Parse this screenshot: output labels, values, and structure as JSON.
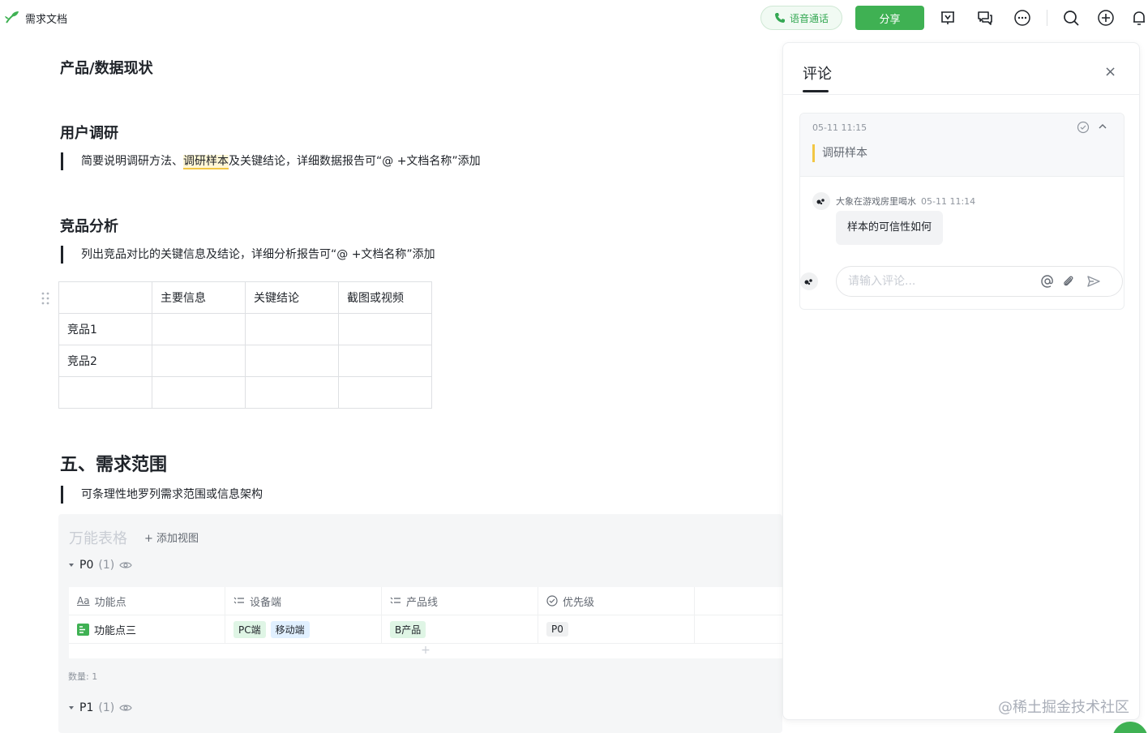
{
  "topbar": {
    "doc_title": "需求文档",
    "voice_call_label": "语音通话",
    "share_label": "分享",
    "accent_color": "#3fb153"
  },
  "doc": {
    "section_product": "产品/数据现状",
    "section_research": "用户调研",
    "research_quote_pre": "简要说明调研方法、",
    "research_quote_highlight": "调研样本",
    "research_quote_post": "及关键结论，详细数据报告可“@ +文档名称”添加",
    "section_competitor": "竞品分析",
    "competitor_quote": "列出竞品对比的关键信息及结论，详细分析报告可“@ +文档名称”添加",
    "competitor_table": {
      "headers": [
        "",
        "主要信息",
        "关键结论",
        "截图或视频"
      ],
      "rows": [
        [
          "竞品1",
          "",
          "",
          ""
        ],
        [
          "竞品2",
          "",
          "",
          ""
        ],
        [
          "",
          "",
          "",
          ""
        ]
      ]
    },
    "section_scope": "五、需求范围",
    "scope_quote": "可条理性地罗列需求范围或信息架构"
  },
  "bitable": {
    "title": "万能表格",
    "add_view": "+ 添加视图",
    "groups": [
      {
        "name": "P0",
        "count": "(1)"
      },
      {
        "name": "P1",
        "count": "(1)"
      }
    ],
    "columns": [
      "功能点",
      "设备端",
      "产品线",
      "优先级"
    ],
    "column_icons": [
      "text-type-icon",
      "multi-select-icon",
      "multi-select-icon",
      "single-select-icon"
    ],
    "rows": [
      {
        "feature": "功能点三",
        "devices": [
          "PC端",
          "移动端"
        ],
        "product_line": "B产品",
        "priority": "P0"
      }
    ],
    "count_label": "数量: 1"
  },
  "panel": {
    "title": "评论",
    "close": "×",
    "card": {
      "time": "05-11 11:15",
      "quote": "调研样本",
      "comment_author": "大象在游戏房里喝水",
      "comment_time": "05-11 11:14",
      "comment_text": "样本的可信性如何",
      "input_placeholder": "请输入评论..."
    }
  },
  "watermark": "@稀土掘金技术社区"
}
